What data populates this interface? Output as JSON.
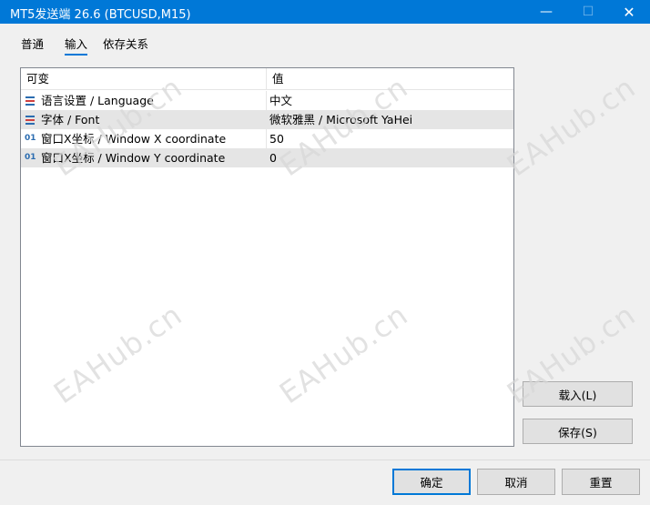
{
  "window": {
    "title": "MT5发送端 26.6 (BTCUSD,M15)",
    "minimize_glyph": "—",
    "maximize_glyph": "☐",
    "close_glyph": "✕"
  },
  "tabs": [
    {
      "label": "普通"
    },
    {
      "label": "输入"
    },
    {
      "label": "依存关系"
    }
  ],
  "grid": {
    "headers": {
      "name": "可变",
      "value": "值"
    },
    "rows": [
      {
        "icon": "list-icon",
        "name": "语言设置 / Language",
        "value": "中文"
      },
      {
        "icon": "list-icon",
        "name": "字体 / Font",
        "value": "微软雅黑 / Microsoft YaHei"
      },
      {
        "icon": "int-icon",
        "icon_text": "01",
        "name": "窗口X坐标 / Window X coordinate",
        "value": "50"
      },
      {
        "icon": "int-icon",
        "icon_text": "01",
        "name": "窗口X坐标 / Window Y coordinate",
        "value": "0"
      }
    ]
  },
  "side_buttons": {
    "load": "载入(L)",
    "save": "保存(S)"
  },
  "bottom_buttons": {
    "ok": "确定",
    "cancel": "取消",
    "reset": "重置"
  },
  "watermark": {
    "text": "EAHub.cn"
  },
  "colors": {
    "titlebar": "#0078d7",
    "accent": "#0078d7",
    "icon_blue": "#2b6cb0",
    "icon_red": "#d04040"
  }
}
